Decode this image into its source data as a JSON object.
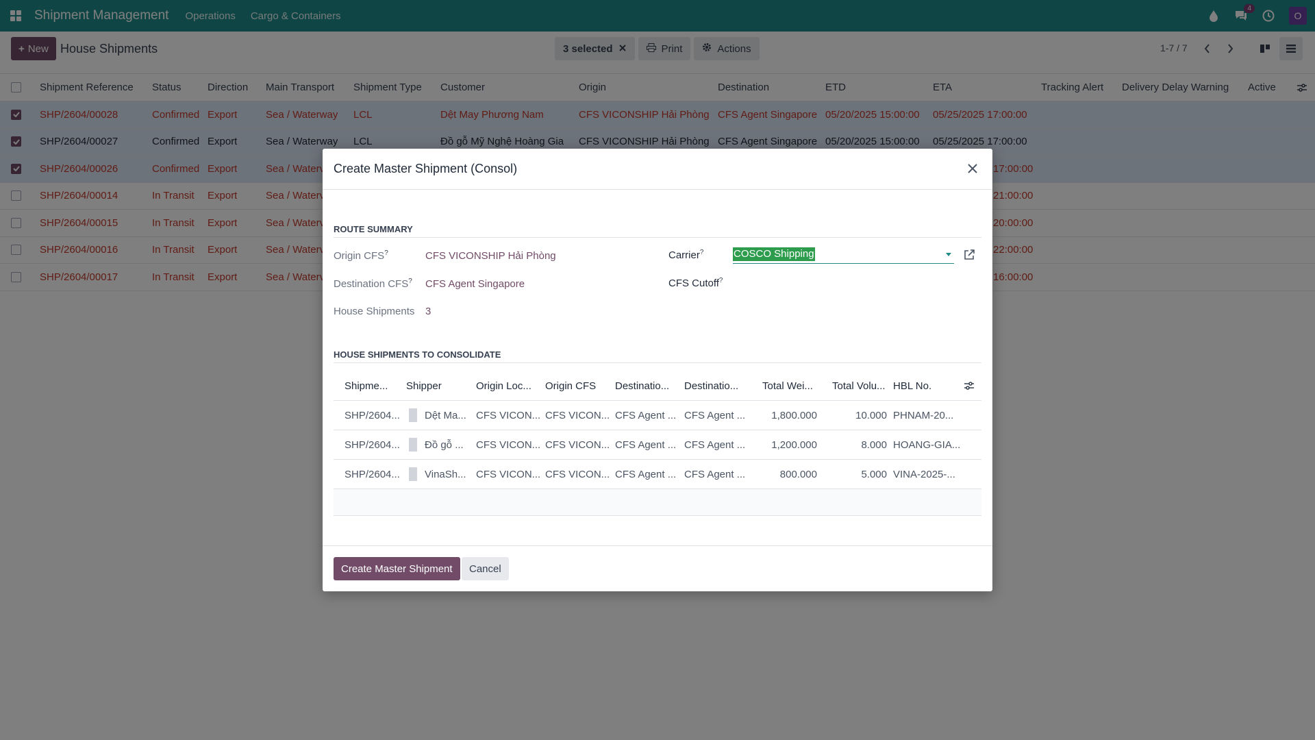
{
  "navbar": {
    "brand": "Shipment Management",
    "menus": [
      "Operations",
      "Cargo & Containers"
    ],
    "messages_badge": "4",
    "avatar_letter": "O"
  },
  "control": {
    "new_label": "New",
    "title": "House Shipments",
    "selected_label": "3 selected",
    "print_label": "Print",
    "actions_label": "Actions",
    "pager": "1-7 / 7"
  },
  "list": {
    "columns": [
      "Shipment Reference",
      "Status",
      "Direction",
      "Main Transport",
      "Shipment Type",
      "Customer",
      "Origin",
      "Destination",
      "ETD",
      "ETA",
      "Tracking Alert",
      "Delivery Delay Warning",
      "Active"
    ],
    "rows": [
      {
        "ref": "SHP/2604/00028",
        "status": "Confirmed",
        "direction": "Export",
        "transport": "Sea / Waterway",
        "type": "LCL",
        "customer": "Dệt May Phương Nam",
        "origin": "CFS VICONSHIP Hải Phòng",
        "destination": "CFS Agent Singapore",
        "etd": "05/20/2025 15:00:00",
        "eta": "05/25/2025 17:00:00"
      },
      {
        "ref": "SHP/2604/00027",
        "status": "Confirmed",
        "direction": "Export",
        "transport": "Sea / Waterway",
        "type": "LCL",
        "customer": "Đồ gỗ Mỹ Nghệ Hoàng Gia",
        "origin": "CFS VICONSHIP Hải Phòng",
        "destination": "CFS Agent Singapore",
        "etd": "05/20/2025 15:00:00",
        "eta": "05/25/2025 17:00:00"
      },
      {
        "ref": "SHP/2604/00026",
        "status": "Confirmed",
        "direction": "Export",
        "transport": "Sea / Waterway",
        "eta_tail": "17:00:00"
      },
      {
        "ref": "SHP/2604/00014",
        "status": "In Transit",
        "direction": "Export",
        "transport": "Sea / Waterway",
        "eta_tail": "21:00:00"
      },
      {
        "ref": "SHP/2604/00015",
        "status": "In Transit",
        "direction": "Export",
        "transport": "Sea / Waterway",
        "eta_tail": "20:00:00"
      },
      {
        "ref": "SHP/2604/00016",
        "status": "In Transit",
        "direction": "Export",
        "transport": "Sea / Waterway",
        "eta_tail": "22:00:00"
      },
      {
        "ref": "SHP/2604/00017",
        "status": "In Transit",
        "direction": "Export",
        "transport": "Sea / Waterway",
        "eta_tail": "16:00:00"
      }
    ],
    "row_transport_short": "Sea / Waterv"
  },
  "modal": {
    "title": "Create Master Shipment (Consol)",
    "route_summary_title": "ROUTE SUMMARY",
    "origin_cfs_label": "Origin CFS",
    "origin_cfs_value": "CFS VICONSHIP Hải Phòng",
    "destination_cfs_label": "Destination CFS",
    "destination_cfs_value": "CFS Agent Singapore",
    "house_shipments_label": "House Shipments",
    "house_shipments_value": "3",
    "carrier_label": "Carrier",
    "carrier_value": "COSCO Shipping",
    "cfs_cutoff_label": "CFS Cutoff",
    "help_mark": "?",
    "consolidate_title": "HOUSE SHIPMENTS TO CONSOLIDATE",
    "sub_columns": [
      "Shipme...",
      "Shipper",
      "Origin Loc...",
      "Origin CFS",
      "Destinatio...",
      "Destinatio...",
      "Total Wei...",
      "Total Volu...",
      "HBL No."
    ],
    "sub_rows": [
      {
        "ref": "SHP/2604...",
        "shipper": "Dệt Ma...",
        "origin_loc": "CFS VICON...",
        "origin_cfs": "CFS VICON...",
        "dest1": "CFS Agent ...",
        "dest2": "CFS Agent ...",
        "weight": "1,800.000",
        "volume": "10.000",
        "hbl": "PHNAM-20..."
      },
      {
        "ref": "SHP/2604...",
        "shipper": "Đồ gỗ ...",
        "origin_loc": "CFS VICON...",
        "origin_cfs": "CFS VICON...",
        "dest1": "CFS Agent ...",
        "dest2": "CFS Agent ...",
        "weight": "1,200.000",
        "volume": "8.000",
        "hbl": "HOANG-GIA..."
      },
      {
        "ref": "SHP/2604...",
        "shipper": "VinaSh...",
        "origin_loc": "CFS VICON...",
        "origin_cfs": "CFS VICON...",
        "dest1": "CFS Agent ...",
        "dest2": "CFS Agent ...",
        "weight": "800.000",
        "volume": "5.000",
        "hbl": "VINA-2025-..."
      }
    ],
    "create_label": "Create Master Shipment",
    "cancel_label": "Cancel"
  },
  "colors": {
    "navbar": "#1e8a88",
    "primary": "#714b67",
    "danger_text": "#c0392b",
    "selected_row": "#dbe6f6",
    "carrier_highlight": "#2d9c4c"
  }
}
